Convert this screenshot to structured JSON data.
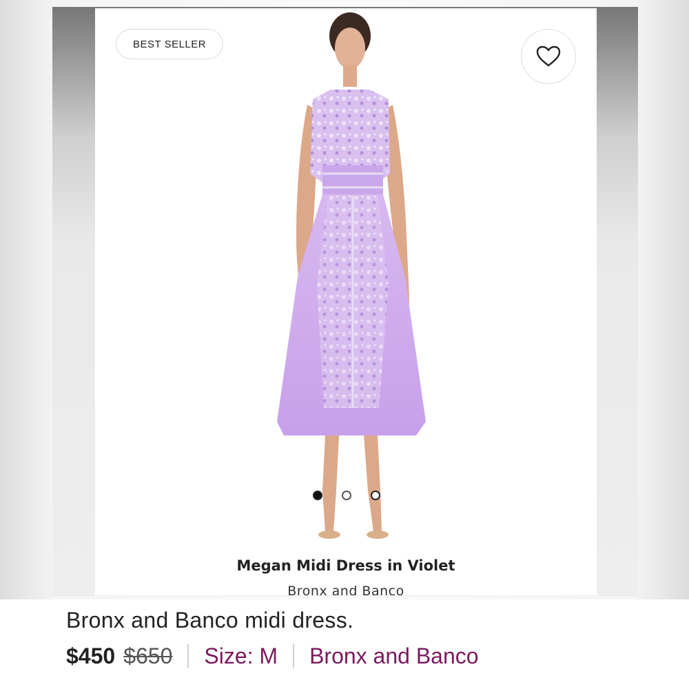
{
  "product_card": {
    "badge": "BEST SELLER",
    "favorite_icon": "heart-outline-icon",
    "product_name": "Megan Midi Dress in Violet",
    "brand": "Bronx and Banco",
    "carousel": {
      "count": 3,
      "active_index": 0
    }
  },
  "listing": {
    "title": "Bronx and Banco midi dress.",
    "price": "$450",
    "original_price": "$650",
    "size_label": "Size: M",
    "brand": "Bronx and Banco"
  },
  "colors": {
    "dress": "#c9a7ea",
    "accent": "#7a1a5c"
  }
}
